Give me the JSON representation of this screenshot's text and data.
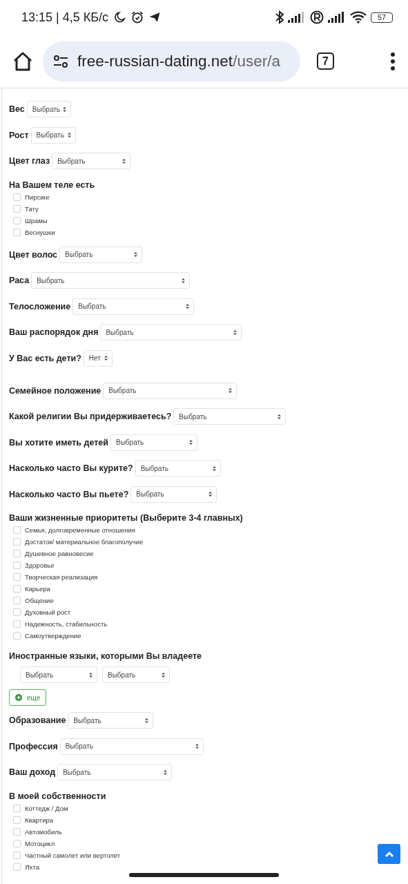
{
  "status_bar": {
    "time": "13:15 | 4,5 КБ/с",
    "battery": "57"
  },
  "browser": {
    "url_host": "free-russian-dating.net",
    "url_path": "/user/a",
    "tab_count": "7"
  },
  "form": [
    {
      "kind": "select",
      "label": "Вес",
      "value": "Выбрать"
    },
    {
      "kind": "select",
      "label": "Рост",
      "value": "Выбрать"
    },
    {
      "kind": "select",
      "label": "Цвет глаз",
      "value": "Выбрать"
    },
    {
      "kind": "checkgroup",
      "heading": "На Вашем теле есть",
      "options": [
        {
          "label": "Пирсинг",
          "checked": false
        },
        {
          "label": "Тату",
          "checked": false
        },
        {
          "label": "Шрамы",
          "checked": false
        },
        {
          "label": "Веснушки",
          "checked": false
        }
      ]
    },
    {
      "kind": "select",
      "label": "Цвет волос",
      "value": "Выбрать"
    },
    {
      "kind": "select",
      "label": "Раса",
      "value": "Выбрать"
    },
    {
      "kind": "select",
      "label": "Телосложение",
      "value": "Выбрать"
    },
    {
      "kind": "select",
      "label": "Ваш распорядок дня",
      "value": "Выбрать"
    },
    {
      "kind": "select",
      "label": "У Вас есть дети?",
      "value": "Нет"
    },
    {
      "kind": "select",
      "label": "Семейное положение",
      "value": "Выбрать"
    },
    {
      "kind": "select",
      "label": "Какой религии Вы придерживаетесь?",
      "value": "Выбрать"
    },
    {
      "kind": "select",
      "label": "Вы хотите иметь детей",
      "value": "Выбрать"
    },
    {
      "kind": "select",
      "label": "Насколько часто Вы курите?",
      "value": "Выбрать"
    },
    {
      "kind": "select",
      "label": "Насколько часто Вы пьете?",
      "value": "Выбрать"
    },
    {
      "kind": "checkgroup",
      "heading": "Ваши жизненные приоритеты (Выберите 3-4 главных)",
      "options": [
        {
          "label": "Семья, долговременные отношения",
          "checked": false
        },
        {
          "label": "Достаток/ материальное благополучие",
          "checked": false
        },
        {
          "label": "Душевное равновесие",
          "checked": false
        },
        {
          "label": "Здоровье",
          "checked": false
        },
        {
          "label": "Творческая реализация",
          "checked": false
        },
        {
          "label": "Карьера",
          "checked": false
        },
        {
          "label": "Общение",
          "checked": false
        },
        {
          "label": "Духовный рост",
          "checked": false
        },
        {
          "label": "Надежность, стабильность",
          "checked": false
        },
        {
          "label": "Самоутверждение",
          "checked": false
        }
      ]
    },
    {
      "kind": "multiselect",
      "heading": "Иностранные языки, которыми Вы владеете",
      "values": [
        "Выбрать",
        "Выбрать"
      ]
    },
    {
      "kind": "button",
      "label": "еще"
    },
    {
      "kind": "select",
      "label": "Образование",
      "value": "Выбрать"
    },
    {
      "kind": "select",
      "label": "Профессия",
      "value": "Выбрать"
    },
    {
      "kind": "select",
      "label": "Ваш доход",
      "value": "Выбрать"
    },
    {
      "kind": "checkgroup",
      "heading": "В моей собственности",
      "options": [
        {
          "label": "Коттедж / Дом",
          "checked": false
        },
        {
          "label": "Квартира",
          "checked": false
        },
        {
          "label": "Автомобиль",
          "checked": false
        },
        {
          "label": "Мотоцикл",
          "checked": false
        },
        {
          "label": "Частный самолет или вертолет",
          "checked": false
        },
        {
          "label": "Яхта",
          "checked": false
        }
      ]
    }
  ]
}
